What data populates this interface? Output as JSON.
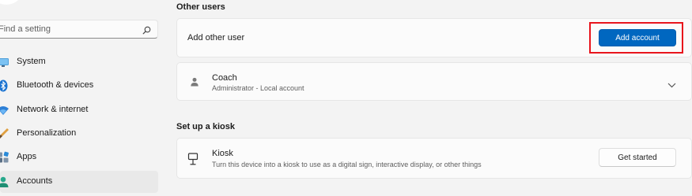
{
  "sidebar": {
    "search": {
      "placeholder": "Find a setting",
      "value": ""
    },
    "items": [
      {
        "label": "System",
        "icon": "system-icon",
        "active": false
      },
      {
        "label": "Bluetooth & devices",
        "icon": "bluetooth-icon",
        "active": false
      },
      {
        "label": "Network & internet",
        "icon": "network-icon",
        "active": false
      },
      {
        "label": "Personalization",
        "icon": "personalization-icon",
        "active": false
      },
      {
        "label": "Apps",
        "icon": "apps-icon",
        "active": false
      },
      {
        "label": "Accounts",
        "icon": "accounts-icon",
        "active": true
      }
    ]
  },
  "main": {
    "other_users": {
      "title": "Other users",
      "add_other_user": {
        "label": "Add other user",
        "button": "Add account"
      },
      "users": [
        {
          "name": "Coach",
          "detail": "Administrator - Local account",
          "icon": "person-icon"
        }
      ]
    },
    "kiosk": {
      "title": "Set up a kiosk",
      "item": {
        "name": "Kiosk",
        "description": "Turn this device into a kiosk to use as a digital sign, interactive display, or other things",
        "button": "Get started",
        "icon": "kiosk-icon"
      }
    }
  },
  "colors": {
    "accent": "#0067c0",
    "highlight_border": "#e8141c",
    "background": "#f3f3f3",
    "card": "#fbfbfb"
  }
}
